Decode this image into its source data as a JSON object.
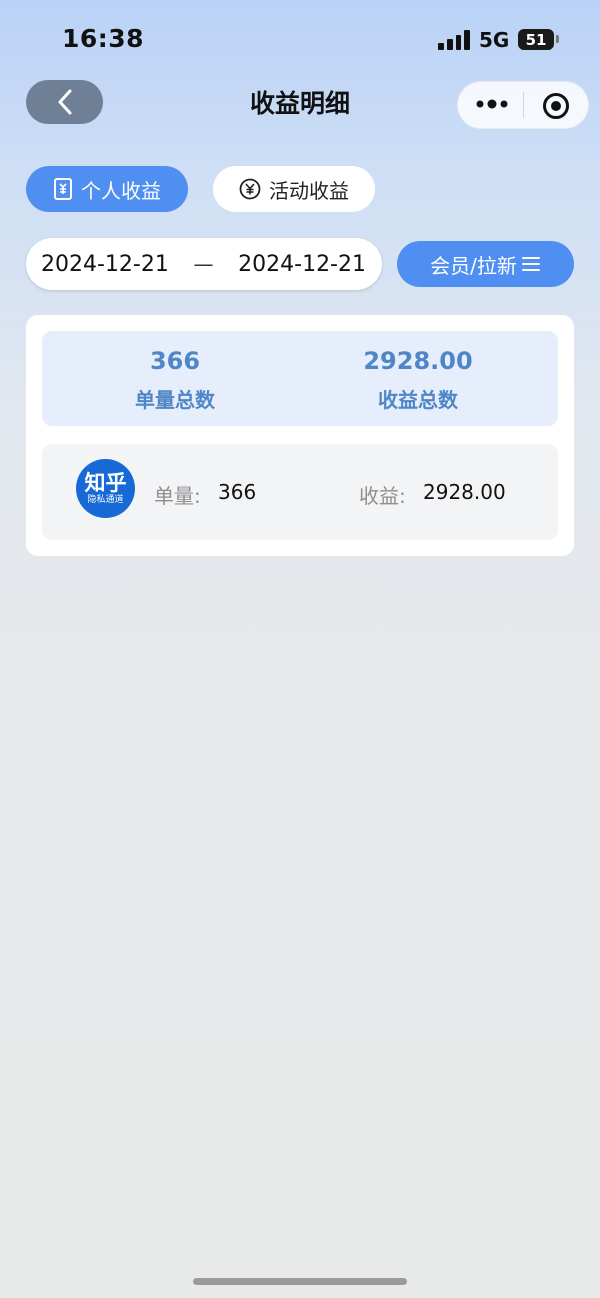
{
  "status_bar": {
    "time": "16:38",
    "network": "5G",
    "battery": "51"
  },
  "nav": {
    "title": "收益明细"
  },
  "tabs": [
    {
      "label": "个人收益",
      "active": true,
      "icon": "receipt-icon"
    },
    {
      "label": "活动收益",
      "active": false,
      "icon": "yen-circle-icon"
    }
  ],
  "date_range": {
    "start": "2024-12-21",
    "separator": "—",
    "end": "2024-12-21"
  },
  "filter": {
    "label": "会员/拉新",
    "icon": "menu-icon"
  },
  "summary": {
    "orders_value": "366",
    "orders_label": "单量总数",
    "earnings_value": "2928.00",
    "earnings_label": "收益总数"
  },
  "rows": [
    {
      "logo_main": "知乎",
      "logo_sub": "隐私通道",
      "orders_label": "单量:",
      "orders_value": "366",
      "earnings_label": "收益:",
      "earnings_value": "2928.00"
    }
  ],
  "colors": {
    "accent": "#4f8ff2",
    "summary_text": "#4f86c8",
    "summary_bg": "#e6eefb",
    "logo_bg": "#1769d6"
  }
}
